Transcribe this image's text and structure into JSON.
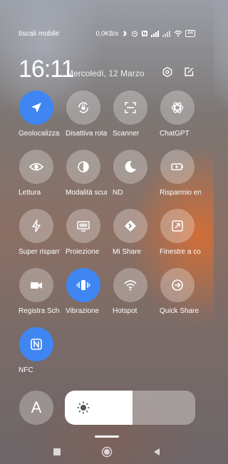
{
  "status": {
    "carrier": "tiscali mobile",
    "speed": "0,0KB/s",
    "battery": "44"
  },
  "header": {
    "time": "16:11",
    "date": "Mercoledì, 12 Marzo",
    "settings_icon": "hexagon-settings-icon",
    "edit_icon": "edit-icon"
  },
  "tiles": [
    {
      "label": "Geolocalizzazione",
      "icon": "location-arrow-icon",
      "active": true
    },
    {
      "label": "Disattiva rotazione",
      "icon": "rotation-lock-icon",
      "active": false
    },
    {
      "label": "Scanner",
      "icon": "scanner-icon",
      "active": false
    },
    {
      "label": "ChatGPT",
      "icon": "chatgpt-icon",
      "active": false
    },
    {
      "label": "Lettura",
      "icon": "eye-icon",
      "active": false
    },
    {
      "label": "Modalità scura",
      "icon": "dark-mode-icon",
      "active": false
    },
    {
      "label": "ND",
      "icon": "moon-icon",
      "active": false
    },
    {
      "label": "Risparmio energetico",
      "icon": "battery-saver-icon",
      "active": false
    },
    {
      "label": "Super risparmio",
      "icon": "lightning-icon",
      "active": false
    },
    {
      "label": "Proiezione",
      "icon": "monitor-icon",
      "active": false
    },
    {
      "label": "Mi Share",
      "icon": "mi-share-icon",
      "active": false
    },
    {
      "label": "Finestre a comparsa",
      "icon": "floating-window-icon",
      "active": false
    },
    {
      "label": "Registra Schermo",
      "icon": "video-camera-icon",
      "active": false
    },
    {
      "label": "Vibrazione",
      "icon": "vibration-icon",
      "active": true
    },
    {
      "label": "Hotspot",
      "icon": "hotspot-icon",
      "active": false
    },
    {
      "label": "Quick Share",
      "icon": "quick-share-icon",
      "active": false
    },
    {
      "label": "NFC",
      "icon": "nfc-icon",
      "active": true
    }
  ],
  "brightness": {
    "auto_label": "A",
    "level": 0.52,
    "icon": "sun-icon"
  },
  "colors": {
    "accent": "#3f86f2",
    "tile_inactive": "rgba(255,255,255,0.28)"
  }
}
